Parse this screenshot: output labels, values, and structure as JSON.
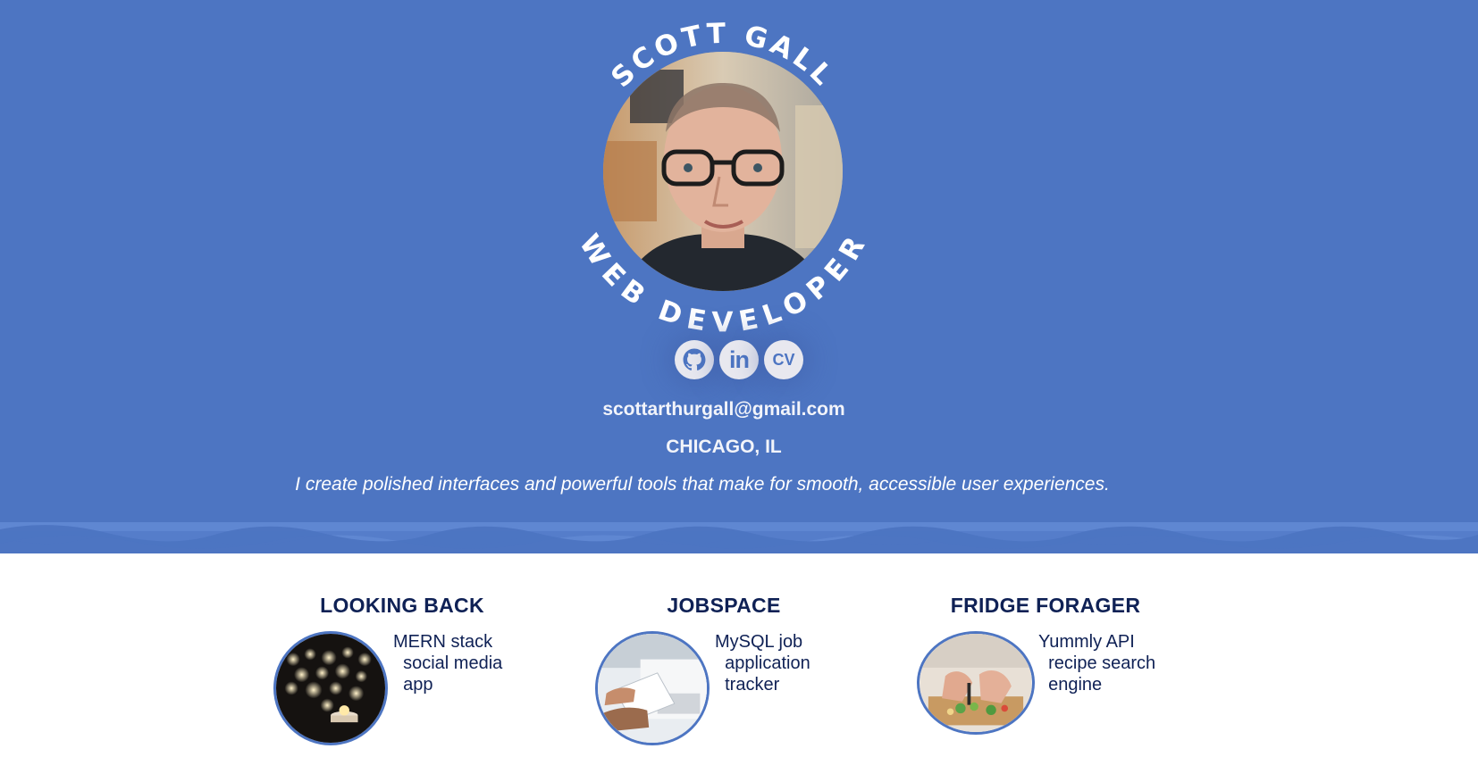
{
  "profile": {
    "name": "SCOTT GALL",
    "role": "WEB DEVELOPER",
    "email": "scottarthurgall@gmail.com",
    "location": "CHICAGO, IL",
    "tagline": "I create polished interfaces and powerful tools that make for smooth, accessible user experiences."
  },
  "social": {
    "linkedin_label": "in",
    "cv_label": "CV"
  },
  "projects": [
    {
      "title": "LOOKING BACK",
      "lines": [
        "MERN stack",
        "  social media",
        "  app"
      ]
    },
    {
      "title": "JOBSPACE",
      "lines": [
        "MySQL job",
        "  application",
        "  tracker"
      ]
    },
    {
      "title": "FRIDGE FORAGER",
      "lines": [
        "Yummly API",
        "  recipe search",
        "  engine"
      ]
    }
  ],
  "colors": {
    "hero_background": "#4d75c2",
    "accent": "#4d75c2",
    "heading_text": "#0f2155"
  }
}
